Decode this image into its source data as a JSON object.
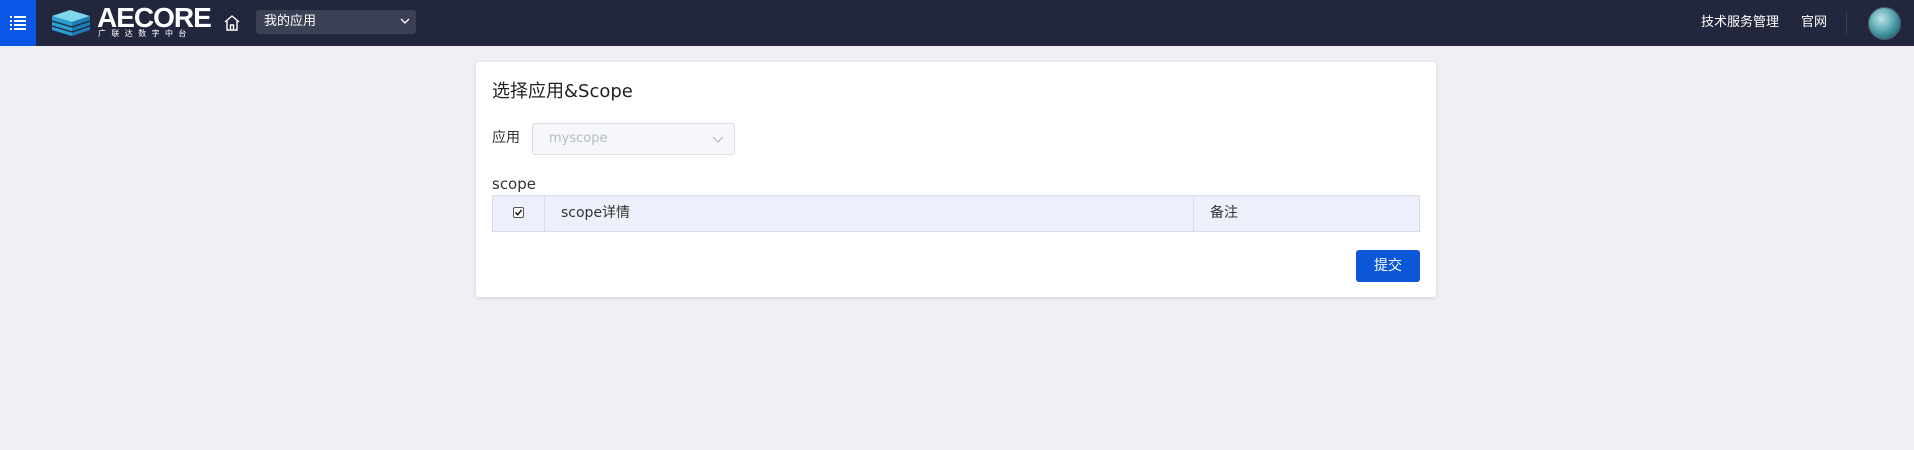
{
  "header": {
    "logo_text": "AECORE",
    "logo_subtitle": "广联达数字中台",
    "app_select_value": "我的应用",
    "links": [
      "技术服务管理",
      "官网"
    ],
    "brand_color": "#0a56e6",
    "icons": {
      "menu": "list-icon",
      "home": "home-icon",
      "select_arrow": "chevron-down-icon"
    }
  },
  "card": {
    "title": "选择应用&Scope",
    "app_label": "应用",
    "app_value": "myscope",
    "scope_label": "scope",
    "table": {
      "select_all_checked": true,
      "columns": [
        "scope详情",
        "备注"
      ],
      "rows": []
    },
    "submit_label": "提交"
  }
}
